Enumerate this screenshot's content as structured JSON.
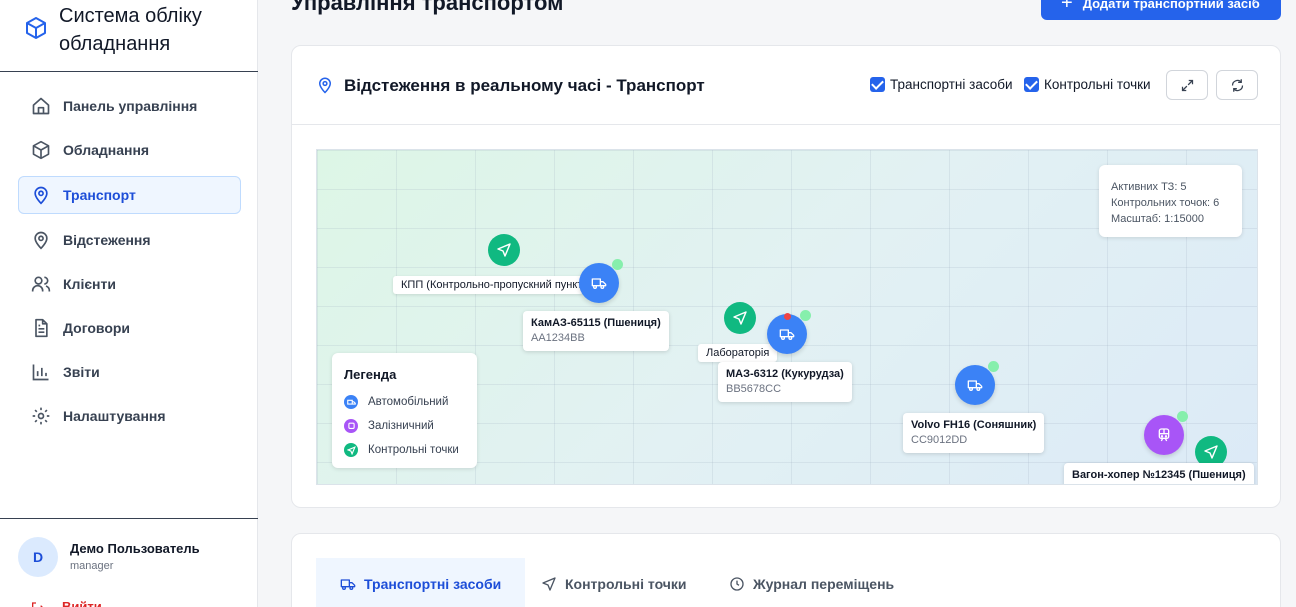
{
  "app": {
    "title": "Система обліку обладнання"
  },
  "sidebar": {
    "items": [
      {
        "label": "Панель управління",
        "icon": "home-icon"
      },
      {
        "label": "Обладнання",
        "icon": "box-icon"
      },
      {
        "label": "Транспорт",
        "icon": "map-pin-icon",
        "active": true
      },
      {
        "label": "Відстеження",
        "icon": "map-pin-icon"
      },
      {
        "label": "Клієнти",
        "icon": "users-icon"
      },
      {
        "label": "Договори",
        "icon": "document-icon"
      },
      {
        "label": "Звіти",
        "icon": "bar-chart-icon"
      },
      {
        "label": "Налаштування",
        "icon": "gear-icon"
      }
    ],
    "user": {
      "initial": "D",
      "name": "Демо Пользователь",
      "role": "manager"
    },
    "logout_label": "Вийти"
  },
  "header": {
    "title": "Управління транспортом",
    "add_button": "Додати транспортний засіб"
  },
  "tracking": {
    "title": "Відстеження в реальному часі - Транспорт",
    "filters": {
      "vehicles": "Транспортні засоби",
      "checkpoints": "Контрольні точки"
    },
    "stats": {
      "active": "Активних ТЗ: 5",
      "checkpoints": "Контрольних точок: 6",
      "scale": "Масштаб: 1:15000"
    },
    "legend": {
      "title": "Легенда",
      "auto": "Автомобільний",
      "rail": "Залізничний",
      "checkpoints": "Контрольні точки"
    },
    "places": {
      "kpp": "КПП (Контрольно-пропускний пункт)",
      "lab": "Лабораторія"
    },
    "vehicles": [
      {
        "name": "КамАЗ-65115 (Пшениця)",
        "plate": "AA1234BB"
      },
      {
        "name": "МАЗ-6312 (Кукурудза)",
        "plate": "BB5678CC"
      },
      {
        "name": "Volvo FH16 (Соняшник)",
        "plate": "CC9012DD"
      },
      {
        "name": "Вагон-хопер №12345 (Пшениця)",
        "plate": ""
      }
    ]
  },
  "tabs": [
    {
      "label": "Транспортні засоби",
      "icon": "truck-icon"
    },
    {
      "label": "Контрольні точки",
      "icon": "navigation-icon"
    },
    {
      "label": "Журнал переміщень",
      "icon": "clock-icon"
    }
  ],
  "colors": {
    "primary": "#2563eb",
    "checkpoint": "#10b981",
    "vehicle": "#3b82f6",
    "rail": "#a855f7"
  }
}
